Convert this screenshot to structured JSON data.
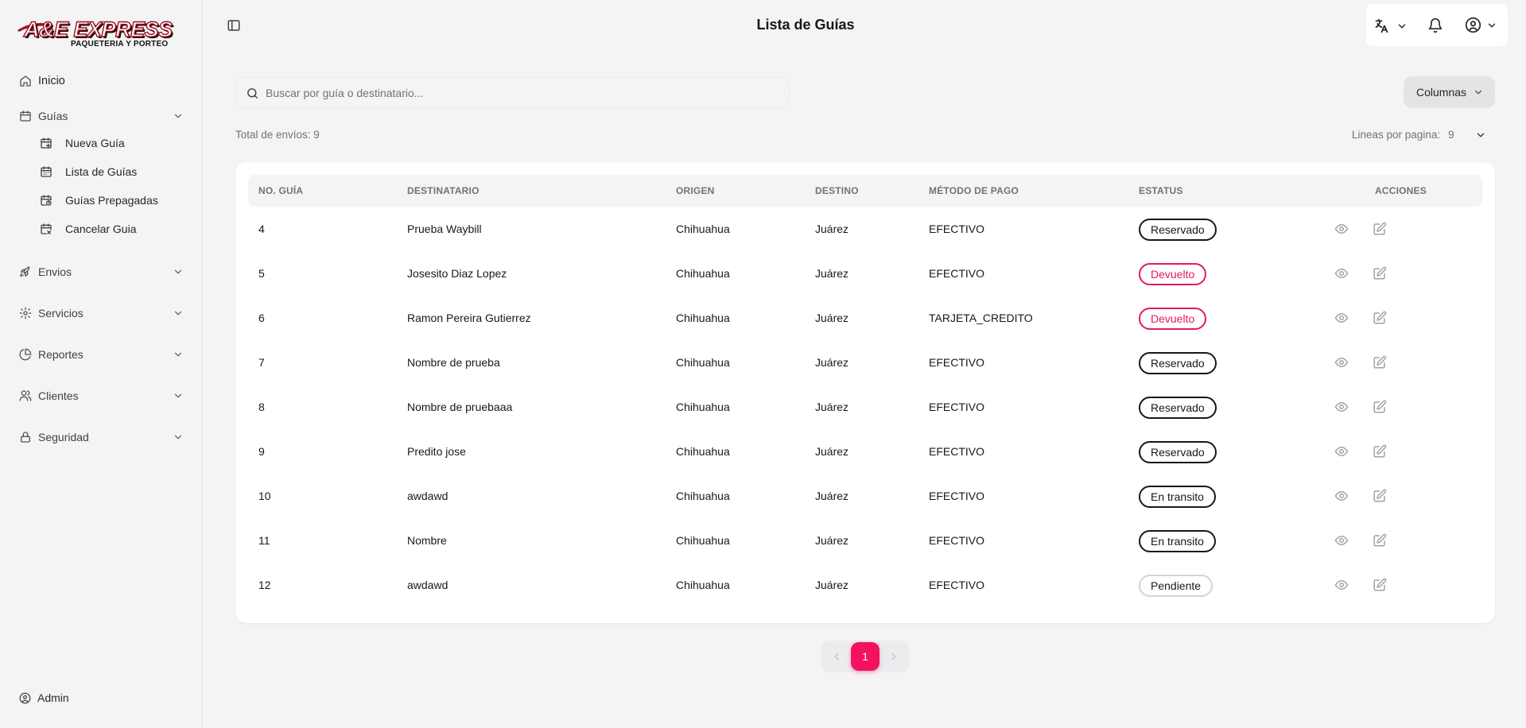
{
  "brand": {
    "name": "A&E EXPRESS",
    "tagline": "PAQUETERIA Y PORTEO",
    "colors": {
      "accent": "#f31260",
      "logo": "#9b1022"
    }
  },
  "header": {
    "title": "Lista de Guías"
  },
  "sidebar": {
    "inicio": "Inicio",
    "guias": "Guías",
    "guias_sub": [
      "Nueva Guía",
      "Lista de Guías",
      "Guías Prepagadas",
      "Cancelar Guia"
    ],
    "envios": "Envios",
    "servicios": "Servicios",
    "reportes": "Reportes",
    "clientes": "Clientes",
    "seguridad": "Seguridad",
    "user": "Admin"
  },
  "toolbar": {
    "search_placeholder": "Buscar por guía o destinatario...",
    "search_value": "",
    "columns_label": "Columnas",
    "total_label": "Total de envíos: 9",
    "per_page_label": "Lineas por pagina:",
    "per_page_value": "9"
  },
  "table": {
    "headers": [
      "NO. GUÍA",
      "DESTINATARIO",
      "ORIGEN",
      "DESTINO",
      "MÉTODO DE PAGO",
      "ESTATUS",
      "ACCIONES"
    ],
    "rows": [
      {
        "id": "4",
        "dest": "Prueba Waybill",
        "origen": "Chihuahua",
        "destino": "Juárez",
        "pago": "EFECTIVO",
        "estatus": "Reservado"
      },
      {
        "id": "5",
        "dest": "Josesito Diaz Lopez",
        "origen": "Chihuahua",
        "destino": "Juárez",
        "pago": "EFECTIVO",
        "estatus": "Devuelto"
      },
      {
        "id": "6",
        "dest": "Ramon Pereira Gutierrez",
        "origen": "Chihuahua",
        "destino": "Juárez",
        "pago": "TARJETA_CREDITO",
        "estatus": "Devuelto"
      },
      {
        "id": "7",
        "dest": "Nombre de prueba",
        "origen": "Chihuahua",
        "destino": "Juárez",
        "pago": "EFECTIVO",
        "estatus": "Reservado"
      },
      {
        "id": "8",
        "dest": "Nombre de pruebaaa",
        "origen": "Chihuahua",
        "destino": "Juárez",
        "pago": "EFECTIVO",
        "estatus": "Reservado"
      },
      {
        "id": "9",
        "dest": "Predito jose",
        "origen": "Chihuahua",
        "destino": "Juárez",
        "pago": "EFECTIVO",
        "estatus": "Reservado"
      },
      {
        "id": "10",
        "dest": "awdawd",
        "origen": "Chihuahua",
        "destino": "Juárez",
        "pago": "EFECTIVO",
        "estatus": "En transito"
      },
      {
        "id": "11",
        "dest": "Nombre",
        "origen": "Chihuahua",
        "destino": "Juárez",
        "pago": "EFECTIVO",
        "estatus": "En transito"
      },
      {
        "id": "12",
        "dest": "awdawd",
        "origen": "Chihuahua",
        "destino": "Juárez",
        "pago": "EFECTIVO",
        "estatus": "Pendiente"
      }
    ]
  },
  "pagination": {
    "current": "1"
  }
}
